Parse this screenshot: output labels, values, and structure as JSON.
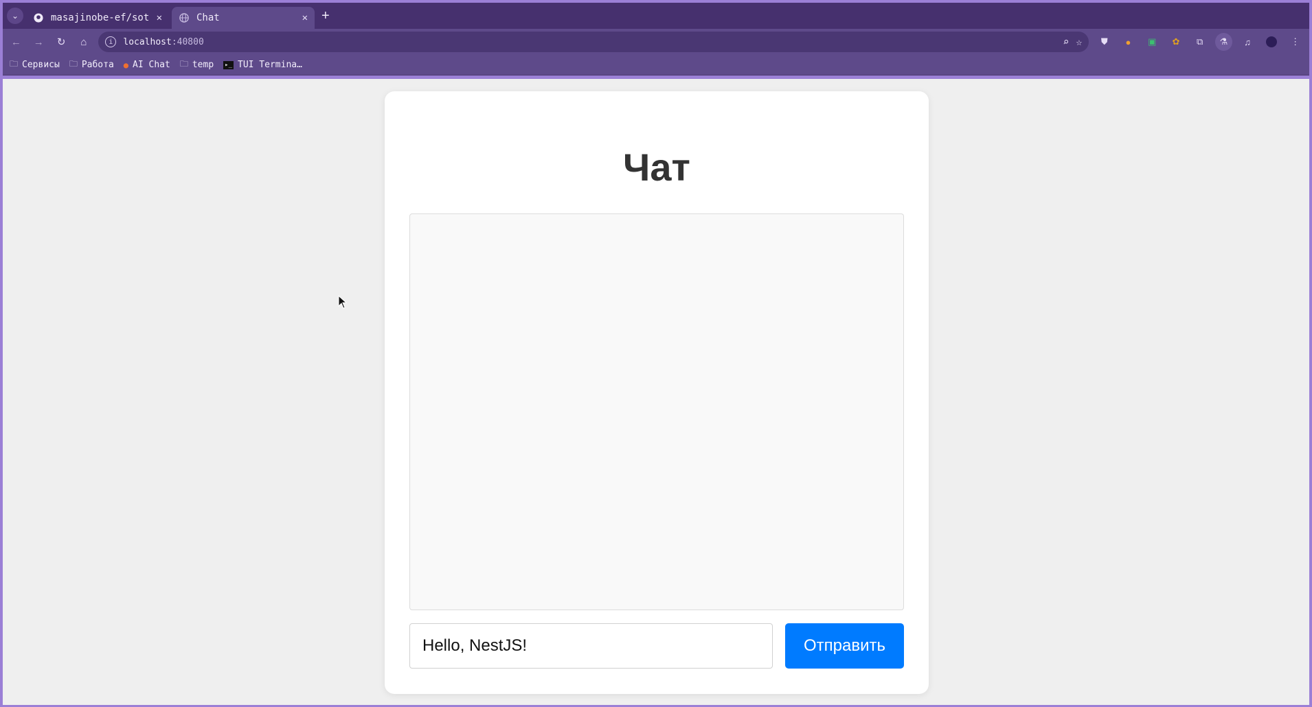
{
  "browser": {
    "tabs": [
      {
        "title": "masajinobe-ef/sotyj",
        "icon": "github-icon",
        "active": false
      },
      {
        "title": "Chat",
        "icon": "globe-icon",
        "active": true
      }
    ],
    "address": {
      "host": "localhost",
      "port": ":40800"
    },
    "bookmarks": [
      {
        "label": "Сервисы",
        "icon": "folder-icon"
      },
      {
        "label": "Работа",
        "icon": "folder-icon"
      },
      {
        "label": "AI Chat",
        "icon": "ai-chat-icon"
      },
      {
        "label": "temp",
        "icon": "folder-icon"
      },
      {
        "label": "TUI Termina…",
        "icon": "terminal-icon"
      }
    ]
  },
  "page": {
    "title": "Чат",
    "input_value": "Hello, NestJS!",
    "send_label": "Отправить"
  },
  "colors": {
    "accent": "#007bff",
    "frame": "#46306e",
    "page_bg": "#efefef"
  }
}
